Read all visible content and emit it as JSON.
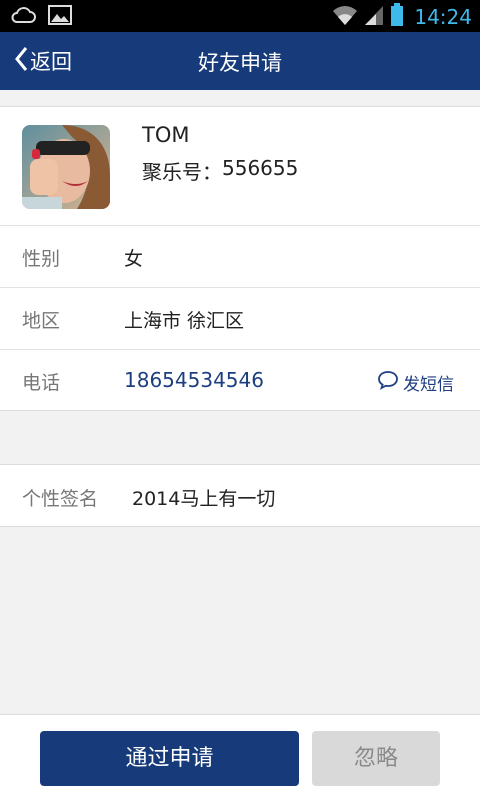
{
  "status_bar": {
    "time": "14:24",
    "icons": [
      "cloud-icon",
      "image-icon",
      "wifi-icon",
      "signal-icon",
      "battery-icon"
    ]
  },
  "nav": {
    "back_label": "返回",
    "title": "好友申请"
  },
  "profile": {
    "name": "TOM",
    "id_label": "聚乐号：",
    "id_value": "556655"
  },
  "details": {
    "gender_label": "性别",
    "gender_value": "女",
    "region_label": "地区",
    "region_value": "上海市 徐汇区",
    "phone_label": "电话",
    "phone_value": "18654534546",
    "sms_label": "发短信"
  },
  "signature": {
    "label": "个性签名",
    "value": "2014马上有一切"
  },
  "actions": {
    "approve_label": "通过申请",
    "ignore_label": "忽略"
  },
  "colors": {
    "brand": "#163a7a",
    "status_time": "#3fb8ea",
    "link": "#1d3e80"
  }
}
